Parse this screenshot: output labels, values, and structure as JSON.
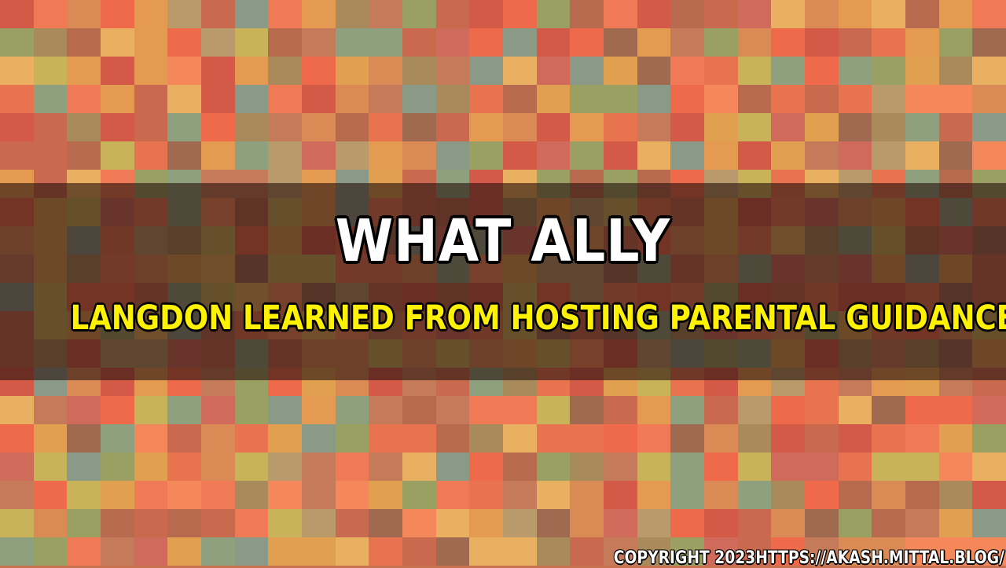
{
  "banner": {
    "title": "WHAT ALLY",
    "subtitle": "LANGDON LEARNED FROM HOSTING PARENTAL GUIDANCE",
    "copyright": "COPYRIGHT 2023HTTPS://AKASH.MITTAL.BLOG/"
  },
  "colors": {
    "title": "#ffffff",
    "subtitle": "#fff200",
    "overlay": "#28140e",
    "palette": [
      "#e8734f",
      "#c9694e",
      "#d98a55",
      "#b86a4f",
      "#ef6a4a",
      "#a98a5a",
      "#c8b25a",
      "#8fa07e",
      "#e59a52",
      "#d45a48",
      "#b99a6a",
      "#f07a55",
      "#a06a50",
      "#9aa062",
      "#e0a050",
      "#c57a5a",
      "#f5885a",
      "#8a9a86",
      "#d06a5a",
      "#e8b060"
    ]
  }
}
